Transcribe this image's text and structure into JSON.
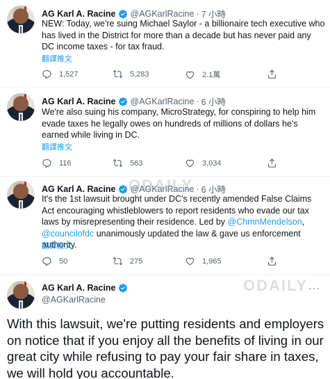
{
  "colors": {
    "link": "#1d9bf0",
    "muted": "#536471",
    "text": "#0f1419",
    "verified": "#1d9bf0"
  },
  "tweets": [
    {
      "name": "AG Karl A. Racine",
      "handle": "@AGKarlRacine",
      "sep": "·",
      "time": "7 小時",
      "text": "NEW: Today, we're suing Michael Saylor - a billionaire tech executive who has lived in the District for more than a decade but has never paid any DC income taxes - for tax fraud.",
      "translate": "翻譯推文",
      "replies": "1,527",
      "retweets": "5,283",
      "likes": "2.1萬"
    },
    {
      "name": "AG Karl A. Racine",
      "handle": "@AGKarlRacine",
      "sep": "·",
      "time": "6 小時",
      "text": "We're also suing his company, MicroStrategy, for conspiring to help him evade taxes he legally owes on hundreds of millions of dollars he's earned while living in DC.",
      "translate": "翻譯推文",
      "replies": "116",
      "retweets": "563",
      "likes": "3,034"
    },
    {
      "name": "AG Karl A. Racine",
      "handle": "@AGKarlRacine",
      "sep": "·",
      "time": "6 小時",
      "text_part1": "It's the 1st lawsuit brought under DC's recently amended False Claims Act encouraging whistleblowers to report residents who evade our tax laws by misrepresenting their residence. Led by ",
      "mention1": "@ChmnMendelson",
      "text_part2": ", ",
      "mention2": "@councilofdc",
      "text_part3": " unanimously updated the law & gave us enforcement authority.",
      "translate": "翻譯推文",
      "replies": "50",
      "retweets": "275",
      "likes": "1,965"
    }
  ],
  "final_tweet": {
    "name": "AG Karl A. Racine",
    "handle": "@AGKarlRacine",
    "more": "···",
    "text": "With this lawsuit, we're putting residents and employers on notice that if you enjoy all the benefits of living in our great city while refusing to pay your fair share in taxes, we will hold you accountable."
  },
  "watermark": "ODAILY"
}
